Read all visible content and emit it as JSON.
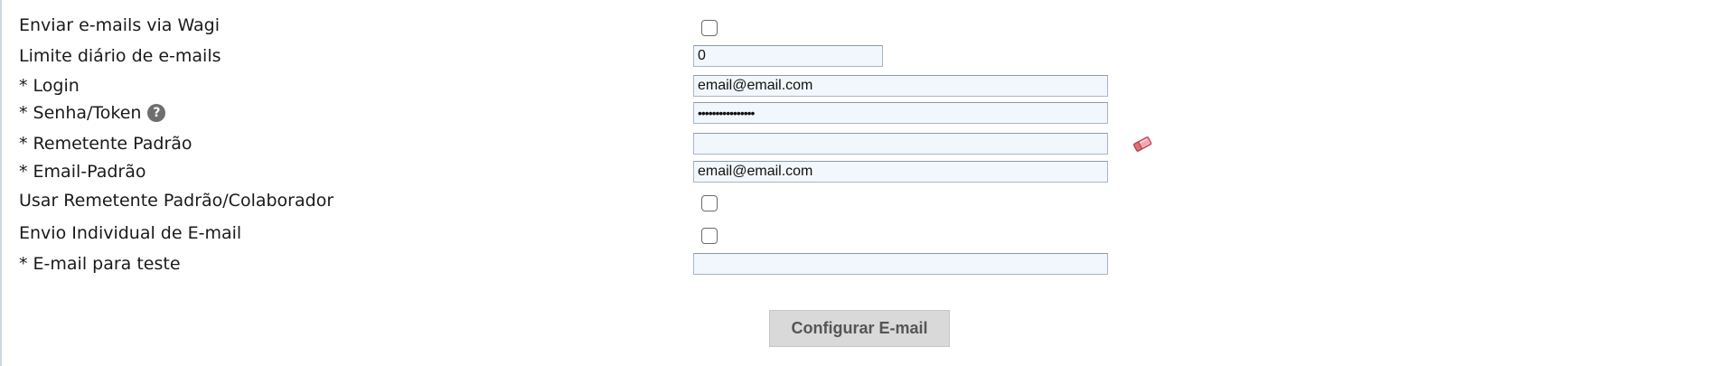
{
  "form": {
    "rows": [
      {
        "label": "Enviar e-mails via Wagi",
        "control": "checkbox",
        "checked": false
      },
      {
        "label": "Limite diário de e-mails",
        "control": "input",
        "value": "0"
      },
      {
        "label": "* Login",
        "control": "input",
        "value": "email@email.com"
      },
      {
        "label": "* Senha/Token",
        "control": "password",
        "value": "••••••••••••••••",
        "help_icon": "question-circle-icon"
      },
      {
        "label": "* Remetente Padrão",
        "control": "input",
        "value": "",
        "action_icon": "eraser-icon"
      },
      {
        "label": "* Email-Padrão",
        "control": "input",
        "value": "email@email.com"
      },
      {
        "label": "Usar Remetente Padrão/Colaborador",
        "control": "checkbox",
        "checked": false
      },
      {
        "label": "Envio Individual de E-mail",
        "control": "checkbox",
        "checked": false
      },
      {
        "label": "* E-mail para teste",
        "control": "input",
        "value": ""
      }
    ],
    "help_glyph": "?",
    "submit_label": "Configurar E-mail"
  },
  "colors": {
    "input_background": "#f2f7fd",
    "input_border": "#a9b6c6",
    "button_background": "#d9d9d9",
    "button_text": "#555555",
    "help_icon": "#6e6e6e",
    "eraser": "#e0707a"
  }
}
